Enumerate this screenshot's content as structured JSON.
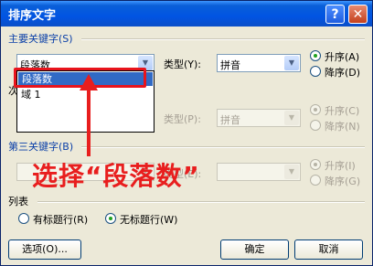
{
  "window": {
    "title": "排序文字",
    "help": "?",
    "close": "✕"
  },
  "sort1": {
    "header": "主要关键字(S)",
    "value": "段落数",
    "type_label": "类型(Y):",
    "type_value": "拼音",
    "asc": "升序(A)",
    "desc": "降序(D)"
  },
  "dropdown": {
    "items": [
      "段落数",
      "域 1"
    ]
  },
  "sort2": {
    "type_label": "类型(P):",
    "type_value": "拼音",
    "asc": "升序(C)",
    "desc": "降序(N)"
  },
  "sort3": {
    "header": "第三关键字(B)",
    "type_label": "类型(E):",
    "asc": "升序(I)",
    "desc": "降序(G)"
  },
  "annotation": {
    "text": "选择“段落数”"
  },
  "list": {
    "header": "列表",
    "has_header": "有标题行(R)",
    "no_header": "无标题行(W)"
  },
  "buttons": {
    "options": "选项(O)...",
    "ok": "确定",
    "cancel": "取消"
  },
  "colors": {
    "annotation": "#e81e1e",
    "title_bar": "#0054e3"
  }
}
